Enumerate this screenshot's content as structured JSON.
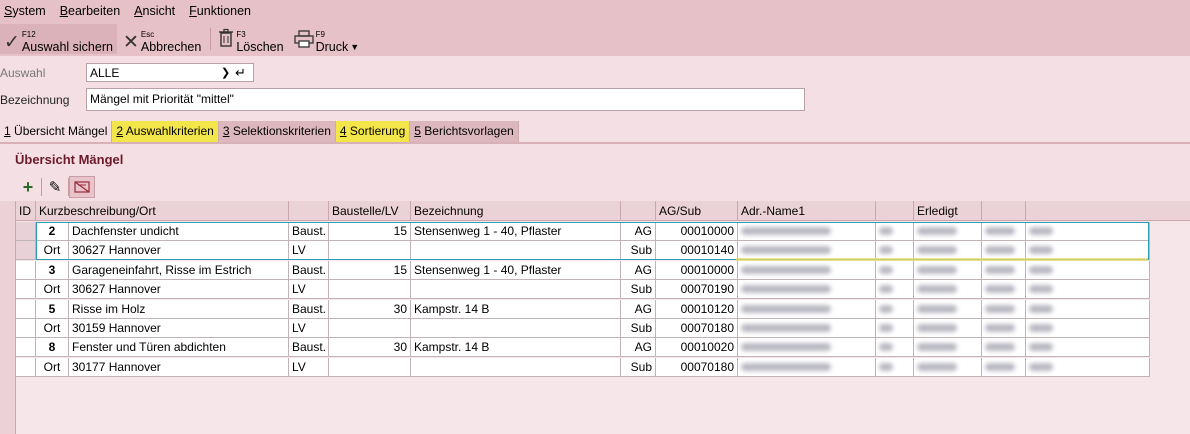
{
  "menu": [
    "System",
    "Bearbeiten",
    "Ansicht",
    "Funktionen"
  ],
  "toolbar": {
    "save": {
      "key": "F12",
      "label": "Auswahl sichern"
    },
    "cancel": {
      "key": "Esc",
      "label": "Abbrechen"
    },
    "delete": {
      "key": "F3",
      "label": "Löschen"
    },
    "print": {
      "key": "F9",
      "label": "Druck"
    }
  },
  "form": {
    "auswahl_label": "Auswahl",
    "auswahl_value": "ALLE",
    "bezeichnung_label": "Bezeichnung",
    "bezeichnung_value": "Mängel mit Priorität \"mittel\""
  },
  "tabs": [
    {
      "num": "1",
      "label": " Übersicht Mängel"
    },
    {
      "num": "2",
      "label": " Auswahlkriterien"
    },
    {
      "num": "3",
      "label": " Selektionskriterien"
    },
    {
      "num": "4",
      "label": " Sortierung"
    },
    {
      "num": "5",
      "label": " Berichtsvorlagen"
    }
  ],
  "section_title": "Übersicht Mängel",
  "grid": {
    "headers": [
      "ID",
      "Kurzbeschreibung/Ort",
      "",
      "Baustelle/LV",
      "Bezeichnung",
      "",
      "AG/Sub",
      "Adr.-Name1",
      "",
      "Erledigt",
      "",
      ""
    ],
    "rows": [
      [
        "2",
        "Dachfenster  undicht",
        "Baust.",
        "15",
        "Stensenweg 1 - 40, Pflaster",
        "AG",
        "00010000"
      ],
      [
        "Ort",
        "30627 Hannover",
        "LV",
        "",
        "",
        "Sub",
        "00010140"
      ],
      [
        "3",
        "Garageneinfahrt, Risse im Estrich",
        "Baust.",
        "15",
        "Stensenweg 1 - 40, Pflaster",
        "AG",
        "00010000"
      ],
      [
        "Ort",
        "30627 Hannover",
        "LV",
        "",
        "",
        "Sub",
        "00070190"
      ],
      [
        "5",
        "Risse im Holz",
        "Baust.",
        "30",
        "Kampstr. 14 B",
        "AG",
        "00010120"
      ],
      [
        "Ort",
        "30159 Hannover",
        "LV",
        "",
        "",
        "Sub",
        "00070180"
      ],
      [
        "8",
        "Fenster und Türen abdichten",
        "Baust.",
        "30",
        "Kampstr. 14 B",
        "AG",
        "00010020"
      ],
      [
        "Ort",
        "30177 Hannover",
        "LV",
        "",
        "",
        "Sub",
        "00070180"
      ]
    ]
  }
}
